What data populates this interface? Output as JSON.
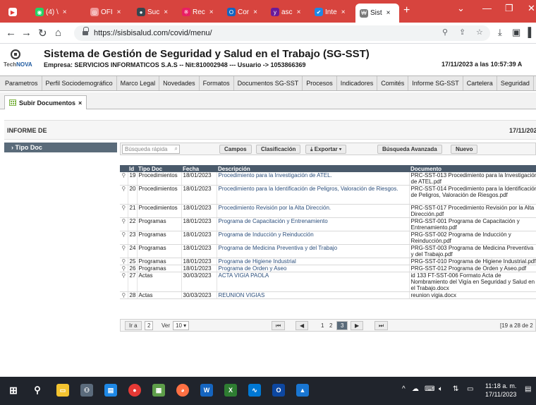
{
  "browser": {
    "tabs": [
      {
        "label": "",
        "color": "#e53935"
      },
      {
        "label": "(4) \\",
        "color": "#2e7d32"
      },
      {
        "label": "OFI",
        "color": "#c62828"
      },
      {
        "label": "Suc",
        "color": "#37474f"
      },
      {
        "label": "Rec",
        "color": "#e91e63"
      },
      {
        "label": "Cor",
        "color": "#1565c0"
      },
      {
        "label": "asc",
        "color": "#6a1b9a"
      },
      {
        "label": "Inte",
        "color": "#1e88e5"
      },
      {
        "label": "Sist",
        "color": "#7b7b7b"
      }
    ],
    "tab_close": "×",
    "new_tab": "+",
    "url": "https://sisbisalud.com/covid/menu/"
  },
  "app": {
    "logo_text_a": "Tech",
    "logo_text_b": "NOVA",
    "title": "Sistema de Gestión de Seguridad y Salud en el Trabajo (SG-SST)",
    "empresa": "Empresa: SERVICIOS INFORMATICOS S.A.S -- Nit:810002948 --- Usuario -> 1053866369",
    "fecha_hora": "17/11/2023 a las 10:57:39 A"
  },
  "menu": [
    "Parametros",
    "Perfil Sociodemográfico",
    "Marco Legal",
    "Novedades",
    "Formatos",
    "Documentos SG-SST",
    "Procesos",
    "Indicadores",
    "Comités",
    "Informe SG-SST",
    "Cartelera",
    "Seguridad"
  ],
  "subtab": {
    "label": "Subir Documentos",
    "close": "×"
  },
  "report": {
    "title": "INFORME DE",
    "date": "17/11/202",
    "side_label": "Tipo Doc",
    "search_placeholder": "Búsqueda rápida",
    "buttons": {
      "campos": "Campos",
      "clasificacion": "Clasificación",
      "exportar": "Exportar",
      "busqueda_avanzada": "Búsqueda Avanzada",
      "nuevo": "Nuevo"
    },
    "columns": [
      "Id",
      "Tipo Doc",
      "Fecha",
      "Descripción",
      "Documento"
    ],
    "rows": [
      {
        "id": "19",
        "tipo": "Procedimientos",
        "fecha": "18/01/2023",
        "desc": "Procedimiento para la Investigación de ATEL.",
        "doc": "PRC-SST-013 Procedimiento para la Investigación de ATEL.pdf"
      },
      {
        "id": "20",
        "tipo": "Procedimientos",
        "fecha": "18/01/2023",
        "desc": "Procedimiento para la Identificación de Peligros, Valoración de Riesgos.",
        "doc": "PRC-SST-014 Procedimiento para la Identificación de Peligros, Valoración de Riesgos.pdf"
      },
      {
        "id": "21",
        "tipo": "Procedimientos",
        "fecha": "18/01/2023",
        "desc": "Procedimiento Revisión por la Alta Dirección.",
        "doc": "PRC-SST-017 Procedimiento Revisión por la Alta Dirección.pdf"
      },
      {
        "id": "22",
        "tipo": "Programas",
        "fecha": "18/01/2023",
        "desc": "Programa de Capacitación y Entrenamiento",
        "doc": "PRG-SST-001 Programa de Capacitación y Entrenamiento.pdf"
      },
      {
        "id": "23",
        "tipo": "Programas",
        "fecha": "18/01/2023",
        "desc": "Programa de Inducción y Reinducción",
        "doc": "PRG-SST-002 Programa de Inducción y Reinducción.pdf"
      },
      {
        "id": "24",
        "tipo": "Programas",
        "fecha": "18/01/2023",
        "desc": "Programa de Medicina Preventiva y del Trabajo",
        "doc": "PRG-SST-003 Programa de Medicina Preventiva y del Trabajo.pdf"
      },
      {
        "id": "25",
        "tipo": "Programas",
        "fecha": "18/01/2023",
        "desc": "Programa de Higiene Industrial",
        "doc": "PRG-SST-010 Programa de Higiene Industrial.pdf"
      },
      {
        "id": "26",
        "tipo": "Programas",
        "fecha": "18/01/2023",
        "desc": "Programa de Orden y Aseo",
        "doc": "PRG-SST-012 Programa de Orden y Aseo.pdf"
      },
      {
        "id": "27",
        "tipo": "Actas",
        "fecha": "30/03/2023",
        "desc": "ACTA VIGIA PAOLA",
        "doc": "id 133 FT-SST-006 Formato Acta de Nombramiento del Vigía en Seguridad y Salud en el Trabajo.docx"
      },
      {
        "id": "28",
        "tipo": "Actas",
        "fecha": "30/03/2023",
        "desc": "REUNION VIGIAS",
        "doc": "reunion vigia.docx"
      }
    ],
    "pager": {
      "ir_a": "Ir a",
      "page_input": "2",
      "ver_label": "Ver",
      "ver_value": "10",
      "page_1": "1",
      "page_2": "2",
      "page_3": "3",
      "range": "[19 a 28 de 2"
    }
  },
  "taskbar": {
    "time": "11:18 a. m.",
    "date": "17/11/2023"
  }
}
